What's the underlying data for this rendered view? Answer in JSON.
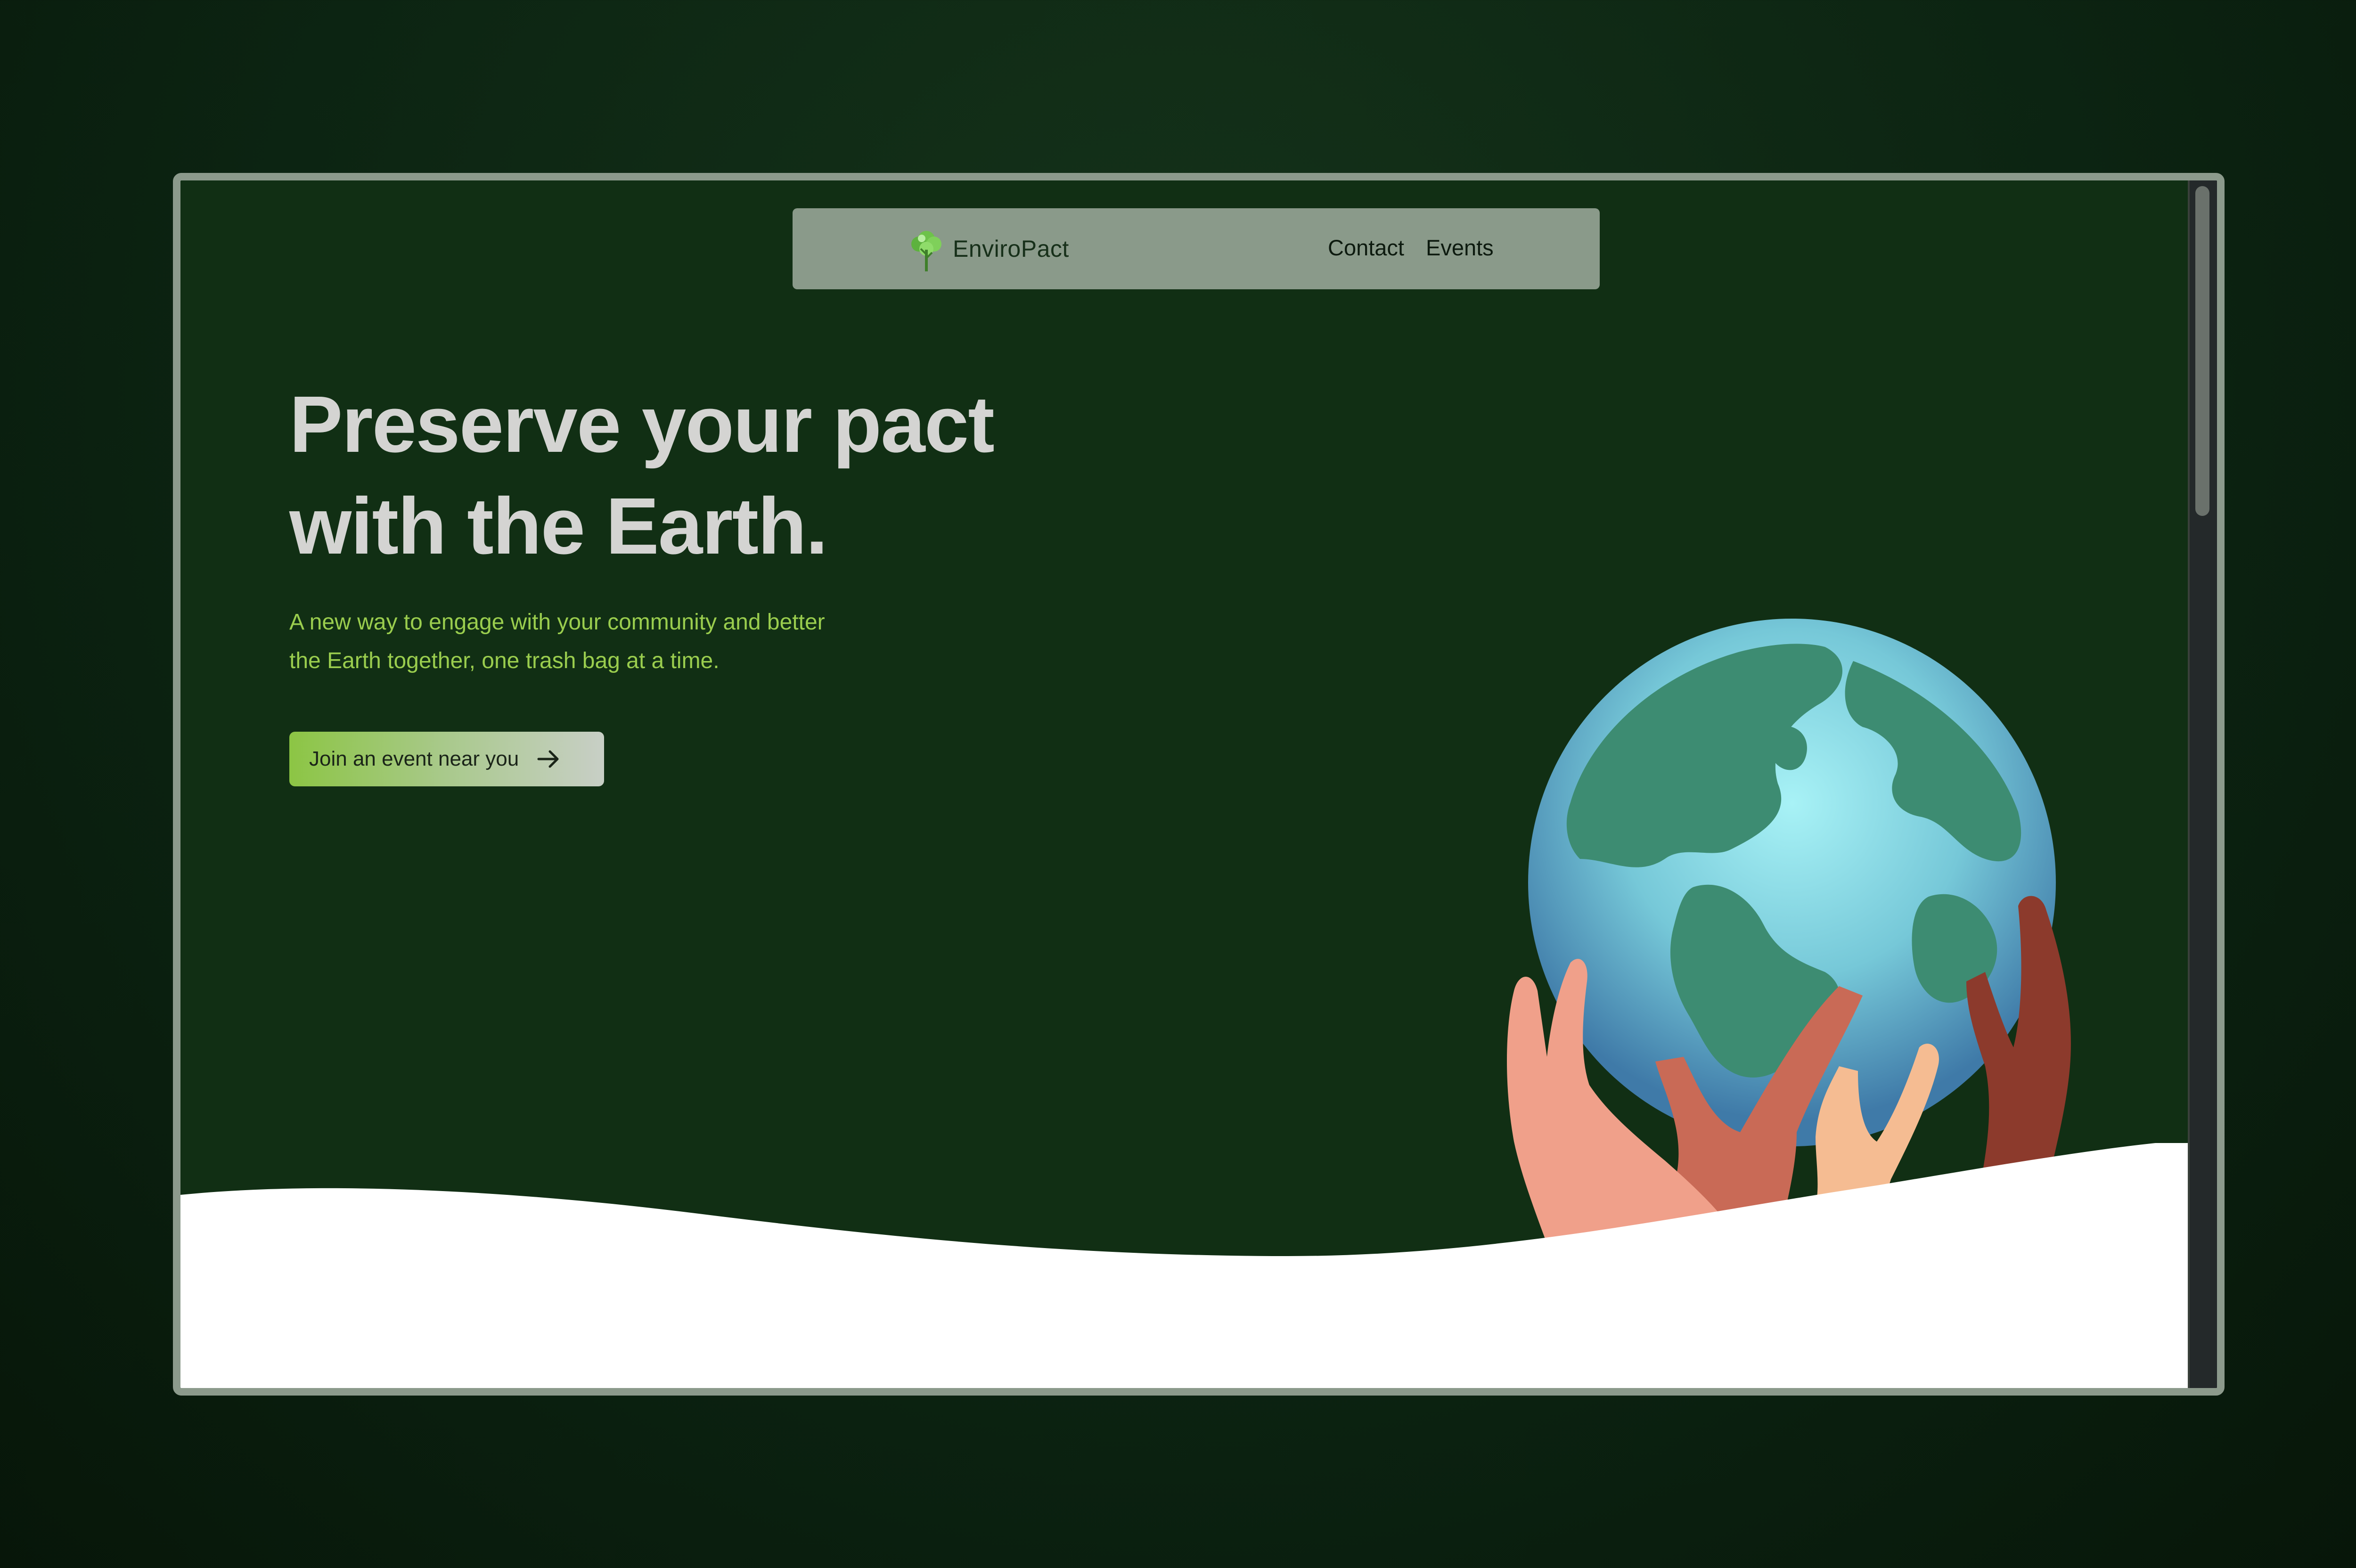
{
  "header": {
    "brand": "EnviroPact",
    "nav": [
      {
        "label": "Contact"
      },
      {
        "label": "Events"
      }
    ]
  },
  "hero": {
    "title_line1": "Preserve your pact",
    "title_line2": "with the Earth.",
    "subtitle_line1": "A new way to engage with your community and better",
    "subtitle_line2": "the Earth together, one trash bag at a time.",
    "cta_label": "Join an event near you"
  },
  "icons": {
    "logo": "tree-icon",
    "cta": "arrow-right-icon"
  },
  "colors": {
    "background": "#112f14",
    "navbar": "#8a9a8a",
    "title": "#d4d4d2",
    "subtitle": "#9acd4e",
    "cta_start": "#8cc544",
    "cta_end": "#c8cfc6",
    "wave": "#ffffff"
  }
}
